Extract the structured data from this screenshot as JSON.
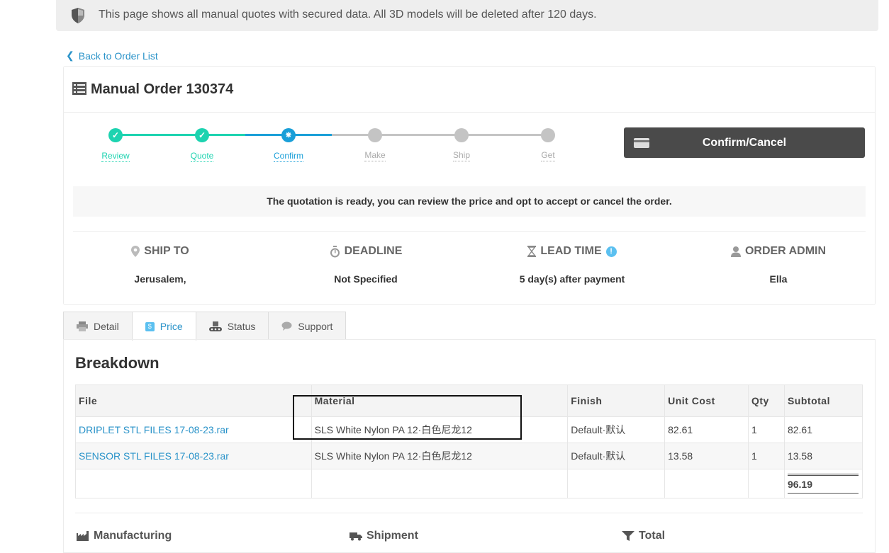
{
  "banner": {
    "text": "This page shows all manual quotes with secured data. All 3D models will be deleted after 120 days.",
    "icon": "shield-icon"
  },
  "nav": {
    "back_label": "Back to Order List"
  },
  "order": {
    "title": "Manual Order 130374",
    "steps": [
      {
        "label": "Review",
        "state": "done"
      },
      {
        "label": "Quote",
        "state": "done"
      },
      {
        "label": "Confirm",
        "state": "current"
      },
      {
        "label": "Make",
        "state": "pending"
      },
      {
        "label": "Ship",
        "state": "pending"
      },
      {
        "label": "Get",
        "state": "pending"
      }
    ],
    "confirm_button": "Confirm/Cancel",
    "notice": "The quotation is ready, you can review the price and opt to accept or cancel the order.",
    "info": {
      "ship_to": {
        "label": "SHIP TO",
        "value": "Jerusalem,"
      },
      "deadline": {
        "label": "DEADLINE",
        "value": "Not Specified"
      },
      "lead_time": {
        "label": "LEAD TIME",
        "value": "5 day(s) after payment"
      },
      "order_admin": {
        "label": "ORDER ADMIN",
        "value": "Ella"
      }
    }
  },
  "tabs": [
    {
      "label": "Detail",
      "icon": "printer-icon"
    },
    {
      "label": "Price",
      "icon": "dollar-icon",
      "active": true
    },
    {
      "label": "Status",
      "icon": "conveyor-icon"
    },
    {
      "label": "Support",
      "icon": "chat-icon"
    }
  ],
  "breakdown": {
    "title": "Breakdown",
    "columns": [
      "File",
      "Material",
      "Finish",
      "Unit Cost",
      "Qty",
      "Subtotal"
    ],
    "rows": [
      {
        "file": "DRIPLET STL FILES 17-08-23.rar",
        "material": "SLS White Nylon PA 12·白色尼龙12",
        "finish": "Default·默认",
        "unit_cost": "82.61",
        "qty": "1",
        "subtotal": "82.61"
      },
      {
        "file": "SENSOR STL FILES 17-08-23.rar",
        "material": "SLS White Nylon PA 12·白色尼龙12",
        "finish": "Default·默认",
        "unit_cost": "13.58",
        "qty": "1",
        "subtotal": "13.58"
      }
    ],
    "total": "96.19"
  },
  "sections": {
    "manufacturing": "Manufacturing",
    "shipment": "Shipment",
    "total": "Total"
  },
  "colors": {
    "done": "#1dd3b0",
    "current": "#1a9fd8",
    "pending": "#c4c4c4",
    "link": "#2a93c9",
    "button": "#4a4a4a"
  }
}
